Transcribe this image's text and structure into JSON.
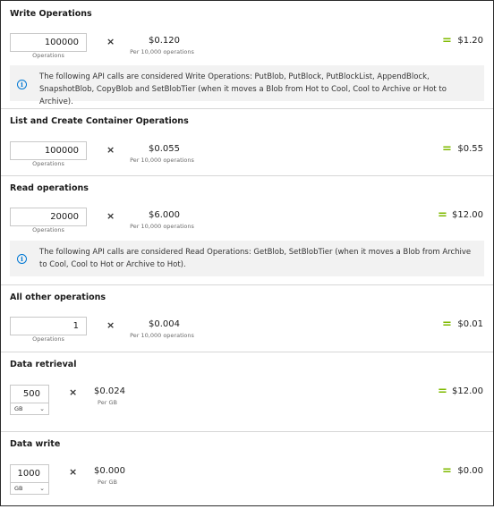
{
  "sections": {
    "write": {
      "title": "Write Operations",
      "qty": "100000",
      "qty_label": "Operations",
      "times": "×",
      "price": "$0.120",
      "price_sub": "Per 10,000 operations",
      "eq": "=",
      "total": "$1.20",
      "info": "The following API calls are considered Write Operations: PutBlob, PutBlock, PutBlockList, AppendBlock, SnapshotBlob, CopyBlob and SetBlobTier (when it moves a Blob from Hot to Cool, Cool to Archive or Hot to Archive)."
    },
    "list": {
      "title": "List and Create Container Operations",
      "qty": "100000",
      "qty_label": "Operations",
      "times": "×",
      "price": "$0.055",
      "price_sub": "Per 10,000 operations",
      "eq": "=",
      "total": "$0.55"
    },
    "read": {
      "title": "Read operations",
      "qty": "20000",
      "qty_label": "Operations",
      "times": "×",
      "price": "$6.000",
      "price_sub": "Per 10,000 operations",
      "eq": "=",
      "total": "$12.00",
      "info": "The following API calls are considered Read Operations: GetBlob, SetBlobTier (when it moves a Blob from Archive to Cool, Cool to Hot or Archive to Hot)."
    },
    "other": {
      "title": "All other operations",
      "qty": "1",
      "qty_label": "Operations",
      "times": "×",
      "price": "$0.004",
      "price_sub": "Per 10,000 operations",
      "eq": "=",
      "total": "$0.01"
    },
    "retrieval": {
      "title": "Data retrieval",
      "qty": "500",
      "unit": "GB",
      "times": "×",
      "price": "$0.024",
      "price_sub": "Per GB",
      "eq": "=",
      "total": "$12.00"
    },
    "dwrite": {
      "title": "Data write",
      "qty": "1000",
      "unit": "GB",
      "times": "×",
      "price": "$0.000",
      "price_sub": "Per GB",
      "eq": "=",
      "total": "$0.00"
    }
  },
  "icons": {
    "info": "info-circle-icon",
    "dropdown": "chevron-down-icon"
  },
  "colors": {
    "accent_equals": "#7fba00",
    "info_icon": "#0078d4",
    "info_bg": "#f2f2f2"
  }
}
